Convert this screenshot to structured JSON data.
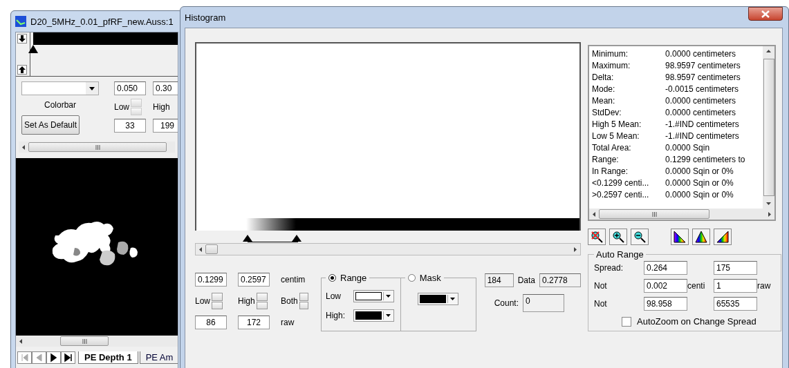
{
  "left_window": {
    "title": "D20_5MHz_0.01_pfRF_new.Auss:1",
    "colorbar_handle": {
      "level": 0.02
    },
    "colorbar_label": "Colorbar",
    "set_default_button": "Set As Default",
    "low_label": "Low",
    "high_label": "High",
    "low_value": "0.050",
    "high_value": "0.30",
    "low_raw": "33",
    "high_raw": "199",
    "tabs": [
      {
        "label": "PE Depth 1",
        "selected": true
      },
      {
        "label": "PE Am",
        "selected": false
      }
    ]
  },
  "histogram": {
    "title": "Histogram",
    "stats": [
      {
        "label": "Minimum:",
        "value": "0.0000 centimeters"
      },
      {
        "label": "Maximum:",
        "value": "98.9597 centimeters"
      },
      {
        "label": "Delta:",
        "value": "98.9597 centimeters"
      },
      {
        "label": "Mode:",
        "value": "-0.0015 centimeters"
      },
      {
        "label": "Mean:",
        "value": "0.0000 centimeters"
      },
      {
        "label": "StdDev:",
        "value": "0.0000 centimeters"
      },
      {
        "label": "High 5 Mean:",
        "value": "-1.#IND centimeters"
      },
      {
        "label": "Low 5 Mean:",
        "value": "-1.#IND centimeters"
      },
      {
        "label": "Total Area:",
        "value": "0.0000 Sqin"
      },
      {
        "label": "Range:",
        "value": "0.1299 centimeters to"
      },
      {
        "label": "In Range:",
        "value": "0.0000 Sqin or 0%"
      },
      {
        "label": "<0.1299 centi...",
        "value": "0.0000 Sqin or 0%"
      },
      {
        "label": ">0.2597 centi...",
        "value": "0.0000 Sqin or 0%"
      }
    ],
    "range_handles": [
      {
        "level": 0.13
      },
      {
        "level": 0.26
      }
    ],
    "range": {
      "low_value": "0.1299",
      "high_value": "0.2597",
      "unit": "centim",
      "low_label": "Low",
      "high_label": "High",
      "both_label": "Both",
      "low_raw": "86",
      "high_raw": "172",
      "raw_unit": "raw"
    },
    "modes": [
      {
        "label": "Range",
        "selected": true
      },
      {
        "label": "Mask",
        "selected": false
      }
    ],
    "range_colors": [
      {
        "label": "Low",
        "color": "#ffffff"
      },
      {
        "label": "High:",
        "color": "#000000"
      }
    ],
    "mask_color": {
      "color": "#000000"
    },
    "data": {
      "index": "184",
      "label": "Data",
      "value": "0.2778",
      "count_label": "Count:",
      "count": "0"
    },
    "auto_range": {
      "title": "Auto Range",
      "spread_label": "Spread:",
      "spread": "0.264",
      "spread_raw": "175",
      "not_low_label": "Not",
      "not_low": "0.002",
      "centi_label": "centi",
      "not_low_raw": "1",
      "raw_label": "raw",
      "not_high_label": "Not",
      "not_high": "98.958",
      "not_high_raw": "65535",
      "autozoom": {
        "label": "AutoZoom on Change Spread",
        "checked": false
      }
    }
  }
}
